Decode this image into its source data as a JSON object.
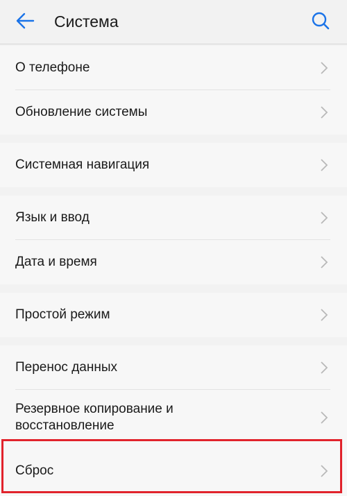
{
  "header": {
    "title": "Система",
    "back_icon": "arrow-left-icon",
    "search_icon": "search-icon"
  },
  "colors": {
    "accent": "#1a73e8",
    "background": "#f2f2f2",
    "item_background": "#f7f7f7",
    "highlight": "#e1232c",
    "chevron": "#b8b8b8"
  },
  "groups": [
    {
      "items": [
        {
          "label": "О телефоне"
        },
        {
          "label": "Обновление системы"
        }
      ]
    },
    {
      "items": [
        {
          "label": "Системная навигация"
        }
      ]
    },
    {
      "items": [
        {
          "label": "Язык и ввод"
        },
        {
          "label": "Дата и время"
        }
      ]
    },
    {
      "items": [
        {
          "label": "Простой режим"
        }
      ]
    },
    {
      "items": [
        {
          "label": "Перенос данных"
        },
        {
          "label": "Резервное копирование и восстановление"
        },
        {
          "label": "Сброс"
        }
      ]
    }
  ]
}
